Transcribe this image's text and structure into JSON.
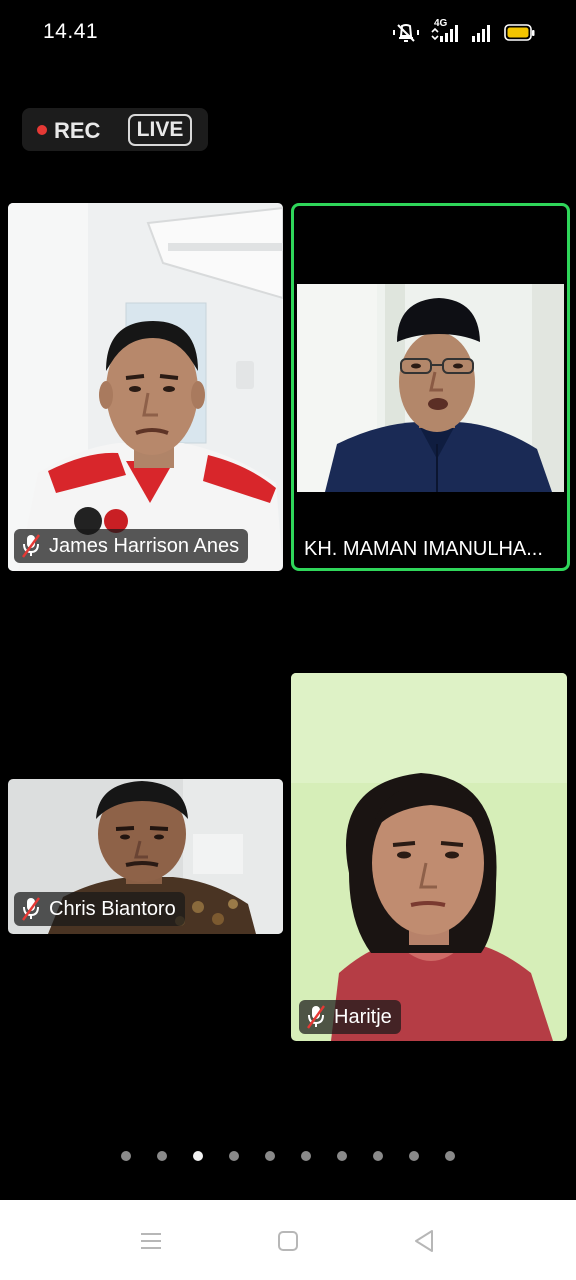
{
  "status_bar": {
    "time": "14.41",
    "network_label": "4G"
  },
  "recording": {
    "rec_label": "REC",
    "live_label": "LIVE"
  },
  "participants": [
    {
      "name": "James Harrison Anes",
      "muted": true
    },
    {
      "name": "KH. MAMAN IMANULHA...",
      "muted": false,
      "active_speaker": true
    },
    {
      "name": "Chris Biantoro",
      "muted": true
    },
    {
      "name": "Haritje",
      "muted": true
    }
  ],
  "pagination": {
    "page_count": 10,
    "current_page": 3
  },
  "nav_bar": {
    "buttons": [
      "recent-apps",
      "home",
      "back"
    ]
  },
  "colors": {
    "active_speaker_border": "#2fd65a",
    "rec_dot": "#e53935",
    "battery": "#f3c500"
  }
}
